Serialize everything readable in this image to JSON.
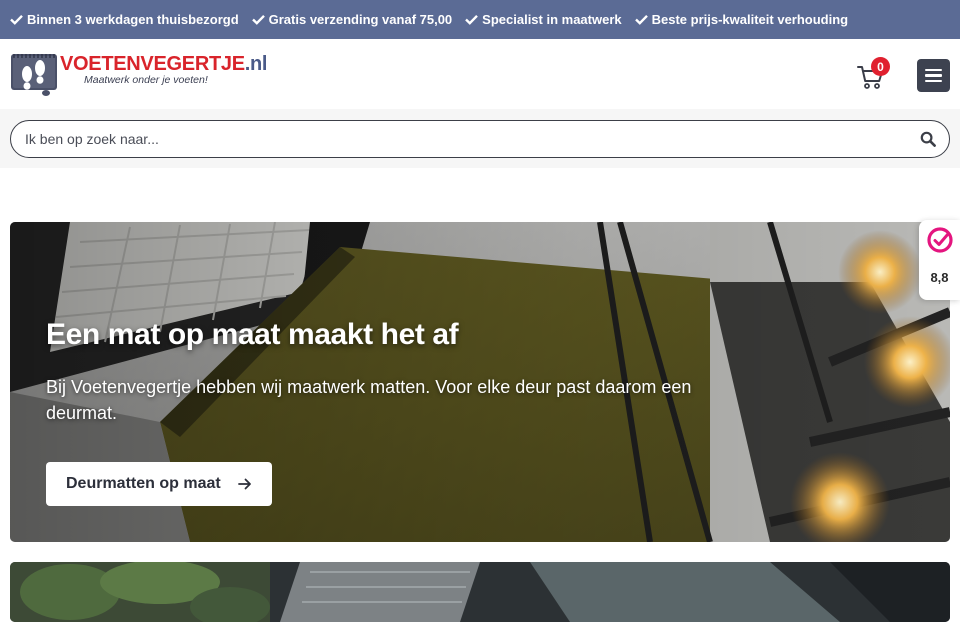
{
  "topbar": {
    "usps": [
      {
        "icon": "check-icon",
        "label": "Binnen 3 werkdagen thuisbezorgd"
      },
      {
        "icon": "check-icon",
        "label": "Gratis verzending vanaf 75,00"
      },
      {
        "icon": "check-icon",
        "label": "Specialist in maatwerk"
      },
      {
        "icon": "check-icon",
        "label": "Beste prijs-kwaliteit verhouding"
      }
    ],
    "background": "#5b6b95"
  },
  "header": {
    "logo": {
      "name_part1": "VOETENVEGERTJE",
      "name_part2": ".nl",
      "tagline": "Maatwerk onder je voeten!"
    },
    "cart": {
      "icon": "cart-icon",
      "count": "0"
    },
    "menu": {
      "icon": "hamburger-menu-icon"
    }
  },
  "search": {
    "placeholder": "Ik ben op zoek naar...",
    "value": "",
    "icon": "search-icon"
  },
  "hero": {
    "title": "Een mat op maat maakt het af",
    "text": "Bij Voetenvegertje hebben wij maatwerk matten. Voor elke deur past daarom een deurmat.",
    "cta_label": "Deurmatten op maat",
    "cta_icon": "arrow-right-icon"
  },
  "rating_widget": {
    "icon": "kiyoh-logo-icon",
    "score": "8,8"
  },
  "colors": {
    "accent_red": "#d9242b",
    "brand_blue": "#4a5a88",
    "badge_red": "#e0202f",
    "menu_dark": "#3d4250"
  }
}
